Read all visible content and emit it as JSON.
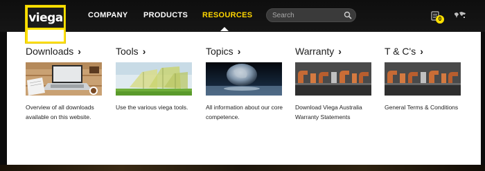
{
  "brand": {
    "logo_text": "viega",
    "accent": "#ffe000"
  },
  "nav": {
    "company": "COMPANY",
    "products": "PRODUCTS",
    "resources": "RESOURCES"
  },
  "search": {
    "placeholder": "Search",
    "icon": "search-icon"
  },
  "cart": {
    "count": "0",
    "icon": "cart-icon"
  },
  "globe": {
    "icon": "globe-icon"
  },
  "menu": {
    "columns": [
      {
        "title": "Downloads",
        "chevron": "›",
        "image": "laptop-desk",
        "description": "Overview of all downloads available on this website."
      },
      {
        "title": "Tools",
        "chevron": "›",
        "image": "buildings",
        "description": "Use the various viega tools."
      },
      {
        "title": "Topics",
        "chevron": "›",
        "image": "earth-globe",
        "description": "All information about our core competence."
      },
      {
        "title": "Warranty",
        "chevron": "›",
        "image": "copper-fittings",
        "description": "Download Viega Australia Warranty Statements"
      },
      {
        "title": "T & C's",
        "chevron": "›",
        "image": "copper-fittings",
        "description": "General Terms & Conditions"
      }
    ]
  }
}
